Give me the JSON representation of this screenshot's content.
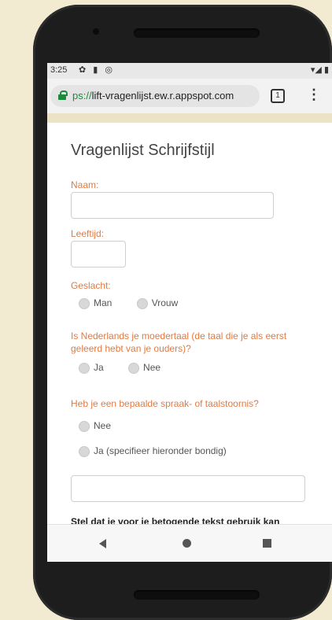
{
  "status": {
    "time": "3:25",
    "left_icons": "✿ ▮ ◎",
    "right_icons": "▾◢ ▮"
  },
  "browser": {
    "url_scheme": "ps://",
    "url_host": "lift-vragenlijst.ew.r.appspot.com",
    "tab_count": "1",
    "menu_icon": "⋮"
  },
  "form": {
    "title": "Vragenlijst Schrijfstijl",
    "naam_label": "Naam:",
    "leeftijd_label": "Leeftijd:",
    "geslacht_label": "Geslacht:",
    "geslacht_options": [
      "Man",
      "Vrouw"
    ],
    "moedertaal_label_line1": "Is Nederlands je moedertaal (de taal die je als eerst",
    "moedertaal_label_line2": "geleerd hebt van je ouders)?",
    "moedertaal_options": [
      "Ja",
      "Nee"
    ],
    "stoornis_label": "Heb je een bepaalde spraak- of taalstoornis?",
    "stoornis_options": [
      "Nee",
      "Ja (specifieer hieronder bondig)"
    ],
    "cut_text": "Stel dat je voor je betogende tekst gebruik kan"
  },
  "icons": {
    "back": "back-triangle-icon",
    "home": "home-circle-icon",
    "recent": "recent-square-icon"
  }
}
